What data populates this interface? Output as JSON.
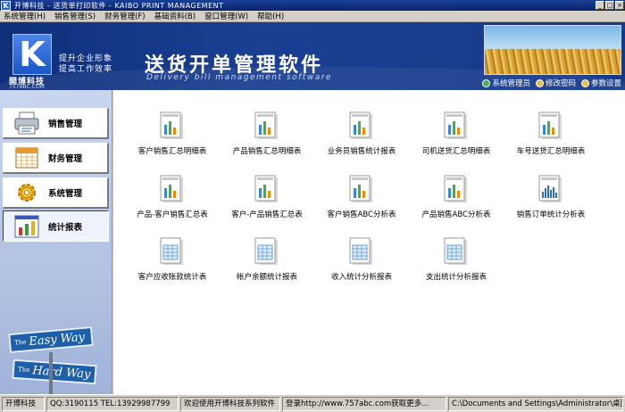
{
  "window": {
    "icon_letter": "K",
    "title": "开博科技 - 送货单打印软件  - KAIBO PRINT MANAGEMENT",
    "min_glyph": "_",
    "max_glyph": "□",
    "close_glyph": "×"
  },
  "menu": [
    {
      "label": "系统管理(H)"
    },
    {
      "label": "销售管理(S)"
    },
    {
      "label": "财务管理(F)"
    },
    {
      "label": "基础资料(B)"
    },
    {
      "label": "窗口管理(W)"
    },
    {
      "label": "帮助(H)"
    }
  ],
  "header": {
    "logo_letter": "K",
    "logo_name": "開博科技",
    "logo_url": "757ABC.COM",
    "slogan_line1": "提升企业形象",
    "slogan_line2": "提高工作效率",
    "title": "送货开单管理软件",
    "subtitle": "Delivery bill management software",
    "links": [
      {
        "label": "系统管理员",
        "icon": "user-icon"
      },
      {
        "label": "修改密码",
        "icon": "key-icon"
      },
      {
        "label": "参数设置",
        "icon": "settings-icon"
      }
    ]
  },
  "sidebar": {
    "items": [
      {
        "label": "销售管理",
        "icon": "printer-icon",
        "active": false
      },
      {
        "label": "财务管理",
        "icon": "calendar-icon",
        "active": false
      },
      {
        "label": "系统管理",
        "icon": "gear-icon",
        "active": false
      },
      {
        "label": "统计报表",
        "icon": "bar-chart-icon",
        "active": true
      }
    ],
    "sign_top": {
      "small": "The",
      "big": "Easy Way"
    },
    "sign_bottom": {
      "small": "The",
      "big": "Hard Way"
    }
  },
  "reports": [
    {
      "label": "客户销售汇总明细表",
      "icon": "bar-chart-report-icon"
    },
    {
      "label": "产品销售汇总明细表",
      "icon": "bar-chart-report-icon"
    },
    {
      "label": "业务员销售统计报表",
      "icon": "bar-chart-report-icon"
    },
    {
      "label": "司机送货汇总明细表",
      "icon": "bar-chart-report-icon"
    },
    {
      "label": "车号送货汇总明细表",
      "icon": "bar-chart-report-icon"
    },
    {
      "label": "产品-客户销售汇总表",
      "icon": "bar-chart-report-icon"
    },
    {
      "label": "客户-产品销售汇总表",
      "icon": "bar-chart-report-icon"
    },
    {
      "label": "客户销售ABC分析表",
      "icon": "bar-chart-report-icon"
    },
    {
      "label": "产品销售ABC分析表",
      "icon": "bar-chart-report-icon"
    },
    {
      "label": "销售订单统计分析表",
      "icon": "column-chart-report-icon"
    },
    {
      "label": "客户应收账款统计表",
      "icon": "table-report-icon"
    },
    {
      "label": "帐户余额统计报表",
      "icon": "table-report-icon"
    },
    {
      "label": "收入统计分析报表",
      "icon": "table-report-icon"
    },
    {
      "label": "支出统计分析报表",
      "icon": "table-report-icon"
    }
  ],
  "status": {
    "company": "开博科技",
    "contact": "QQ:3190115  TEL:13929987799",
    "welcome": "欢迎使用开博科技系列软件",
    "visit": "登录http://www.757abc.com获取更多...",
    "path": "C:\\Documents and Settings\\Administrator\\桌面"
  },
  "colors": {
    "header_blue": "#1a3f92",
    "accent_orange": "#f08a00",
    "bar_blue": "#3a86d8",
    "bar_green": "#3cb04a"
  }
}
